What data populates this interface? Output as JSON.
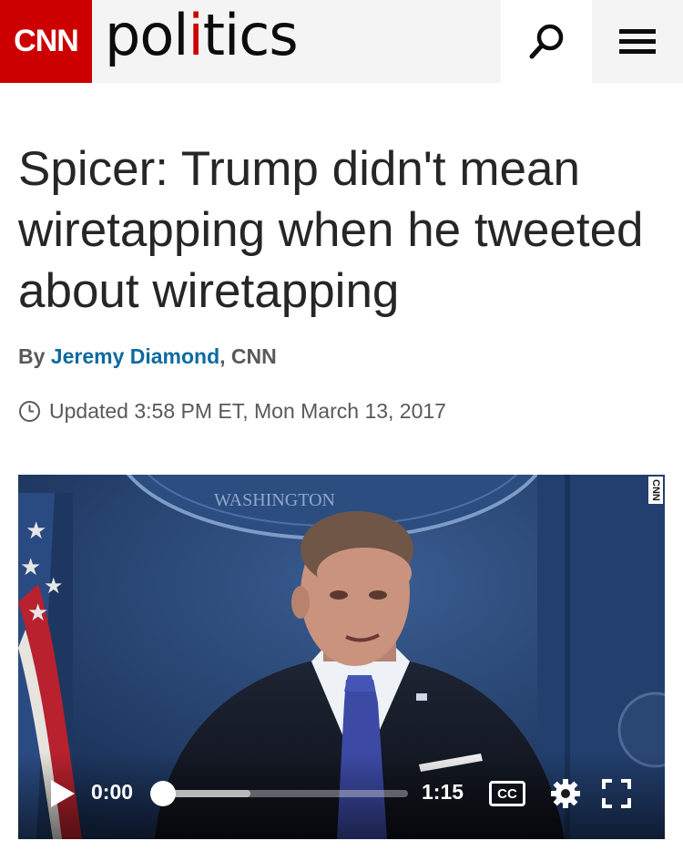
{
  "header": {
    "logo_text": "CNN",
    "section_prefix": "pol",
    "section_i": "i",
    "section_suffix": "tics",
    "brand_color": "#cc0000",
    "search_icon": "search-icon",
    "menu_icon": "hamburger-menu-icon"
  },
  "article": {
    "headline": "Spicer: Trump didn't mean wiretapping when he tweeted about wiretapping",
    "by_prefix": "By",
    "author": "Jeremy Diamond",
    "outlet": ", CNN",
    "updated": "Updated 3:58 PM ET, Mon March 13, 2017",
    "author_color": "#0c6aa0"
  },
  "video": {
    "watermark": "CNN",
    "backdrop_text": "WASHINGTON",
    "current_time": "0:00",
    "duration": "1:15",
    "buffered_fraction": 0.36,
    "played_fraction": 0.0,
    "cc_label": "CC"
  }
}
